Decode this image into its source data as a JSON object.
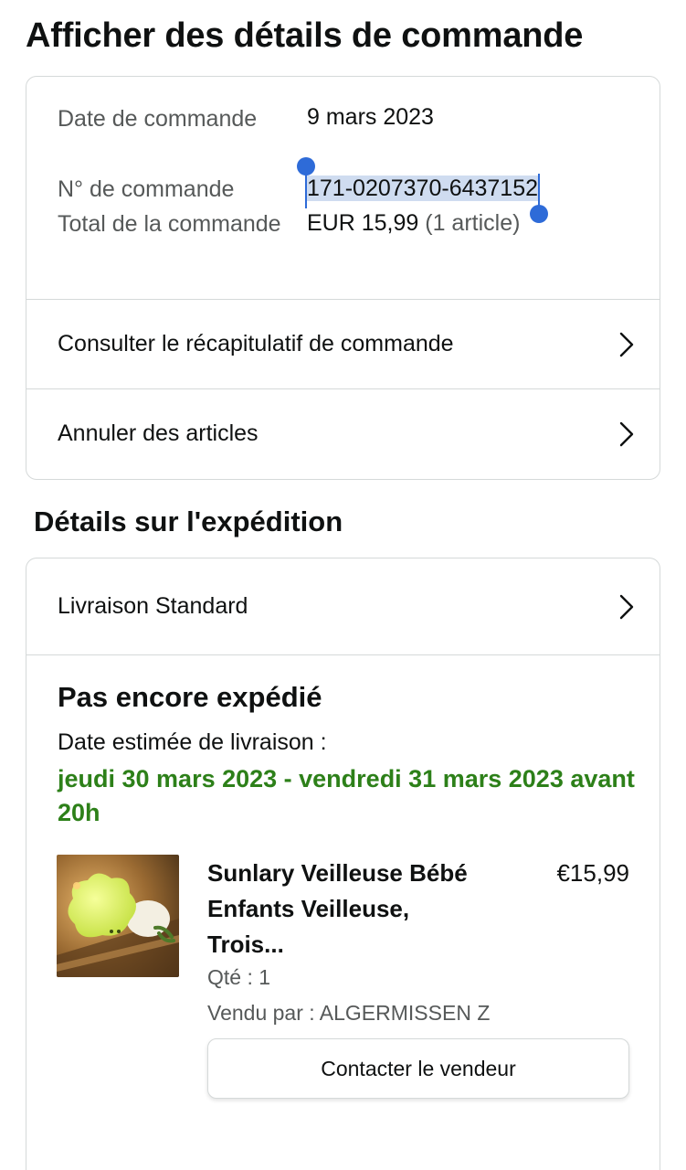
{
  "page": {
    "title": "Afficher des détails de commande"
  },
  "order_info": {
    "date_label": "Date de commande",
    "date_value": "9 mars 2023",
    "number_label": "N° de commande",
    "number_value": "171-0207370-6437152",
    "total_label": "Total de la commande",
    "total_value": "EUR 15,99",
    "total_count": "(1 article)"
  },
  "order_actions": {
    "summary_label": "Consulter le récapitulatif de commande",
    "cancel_label": "Annuler des articles"
  },
  "shipping": {
    "section_title": "Détails sur l'expédition",
    "method_label": "Livraison Standard",
    "status": "Pas encore expédié",
    "estimated_label": "Date estimée de livraison :",
    "estimated_date": "jeudi 30 mars 2023 - vendredi 31 mars 2023 avant 20h"
  },
  "product": {
    "title": "Sunlary Veilleuse Bébé Enfants Veilleuse, Trois...",
    "price": "€15,99",
    "qty": "Qté : 1",
    "seller": "Vendu par : ALGERMISSEN Z",
    "contact_label": "Contacter le vendeur"
  },
  "icons": {
    "chevron": "chevron-right-icon",
    "selection_handles": "text-selection-handle-icon"
  },
  "colors": {
    "delivery_green": "#2d8019",
    "selection_blue": "#2e6bd8",
    "selection_highlight": "#cfdcf0",
    "border": "#d5d9d9"
  }
}
